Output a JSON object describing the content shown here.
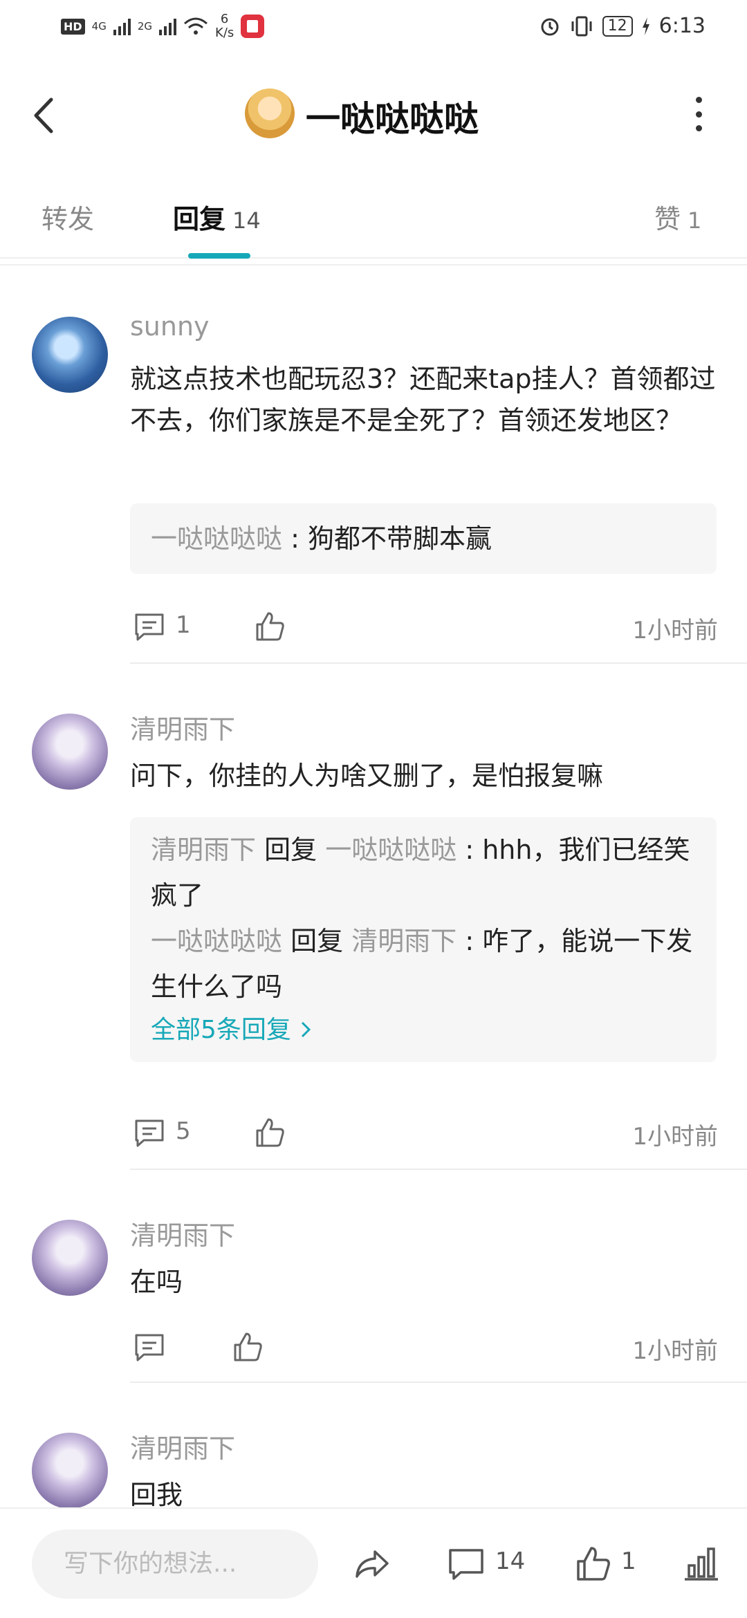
{
  "status": {
    "hd": "HD",
    "net1": "4G",
    "net2": "2G",
    "speed_value": "6",
    "speed_unit": "K/s",
    "battery": "12",
    "time": "6:13"
  },
  "header": {
    "title": "一哒哒哒哒"
  },
  "tabs": [
    {
      "label": "转发",
      "count": ""
    },
    {
      "label": "回复",
      "count": "14"
    },
    {
      "label": "赞",
      "count": "1"
    }
  ],
  "comments": [
    {
      "name": "sunny",
      "text": "就这点技术也配玩忍3？还配来tap挂人？首领都过不去，你们家族是不是全死了？首领还发地区？",
      "replies": [
        {
          "from": "一哒哒哒哒",
          "to": "",
          "text": "狗都不带脚本赢"
        }
      ],
      "reply_count": "1",
      "time": "1小时前"
    },
    {
      "name": "清明雨下",
      "text": "问下，你挂的人为啥又删了，是怕报复嘛",
      "replies": [
        {
          "from": "清明雨下",
          "verb": "回复",
          "to": "一哒哒哒哒",
          "text": "hhh，我们已经笑疯了"
        },
        {
          "from": "一哒哒哒哒",
          "verb": "回复",
          "to": "清明雨下",
          "text": "咋了，能说一下发生什么了吗"
        }
      ],
      "more_label": "全部5条回复",
      "reply_count": "5",
      "time": "1小时前"
    },
    {
      "name": "清明雨下",
      "text": "在吗",
      "reply_count": "",
      "time": "1小时前"
    },
    {
      "name": "清明雨下",
      "text": "回我"
    }
  ],
  "bottom": {
    "input_placeholder": "写下你的想法...",
    "comment_count": "14",
    "like_count": "1"
  },
  "colors": {
    "accent": "#17a8b8"
  },
  "icons": [
    "back-icon",
    "more-icon",
    "comment-icon",
    "like-icon",
    "share-icon",
    "stats-icon",
    "chevron-right-icon"
  ]
}
